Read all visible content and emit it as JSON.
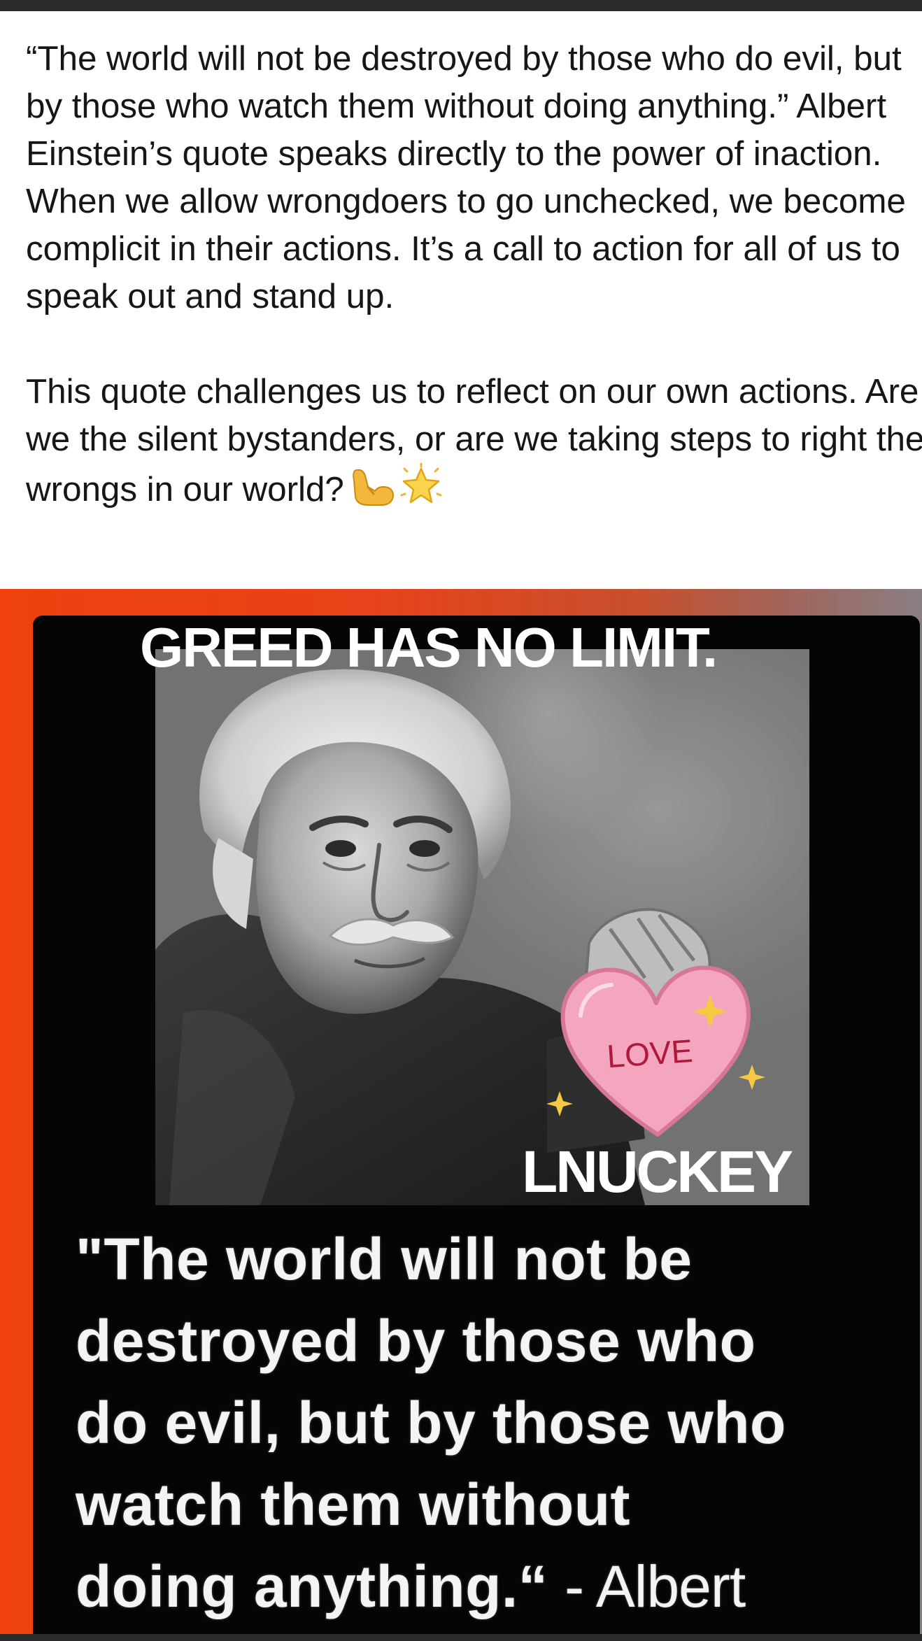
{
  "post": {
    "paragraph_1": "“The world will not be destroyed by those who do evil, but by those who watch them without doing anything.” Albert Einstein’s quote speaks directly to the power of inaction. When we allow wrongdoers to go unchecked, we become complicit in their actions. It’s a call to action for all of us to speak out and stand up.",
    "paragraph_2": "This quote challenges us to reflect on our own actions. Are we the silent bystanders, or are we taking steps to right the wrongs in our world?",
    "emoji_icons": [
      "flexed-biceps-icon",
      "glowing-star-icon"
    ]
  },
  "image": {
    "headline": "GREED HAS NO LIMIT.",
    "sticker_text": "LOVE",
    "signature": "LNUCKEY",
    "caption_lines": [
      "\"The world will not be",
      "destroyed by those who",
      "do evil, but by those who",
      "watch them without",
      "doing anything.“"
    ],
    "caption_attribution": "- Albert"
  },
  "colors": {
    "card_border": "#f0410f",
    "heart_fill": "#f5a6bf",
    "heart_text": "#b0193a",
    "sparkle": "#f7c842"
  }
}
